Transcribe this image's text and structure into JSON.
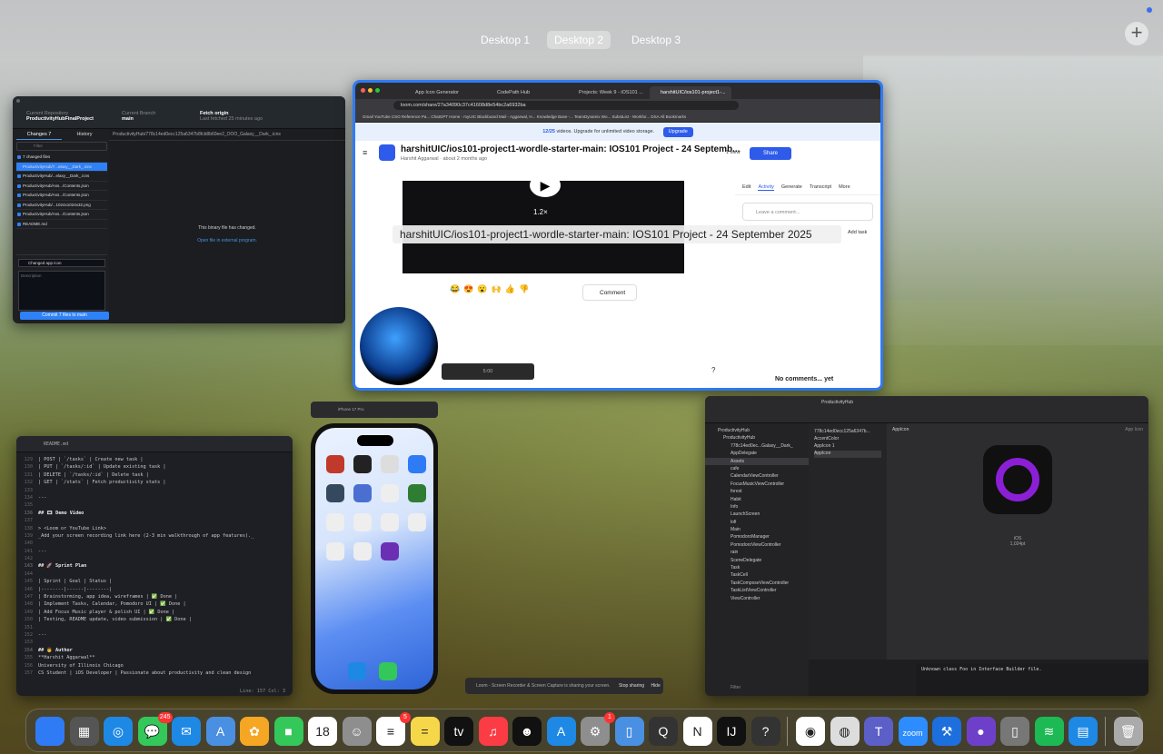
{
  "desktops": [
    "Desktop 1",
    "Desktop 2",
    "Desktop 3"
  ],
  "active_desktop": "Desktop 2",
  "add_desktop": "+",
  "github_desktop": {
    "repo_label": "Current Repository",
    "repo": "ProductivityHubFinalProject",
    "branch_label": "Current Branch",
    "branch": "main",
    "fetch_title": "Fetch origin",
    "fetch_sub": "Last fetched 25 minutes ago",
    "tab_changes": "Changes",
    "tab_changes_count": "7",
    "tab_history": "History",
    "filter_placeholder": "Filter",
    "changed_count": "7 changed files",
    "files": [
      "ProductivityHub/7...elaxy__Dark_.icns",
      "ProductivityHub/...elaxy__Dark_.icns",
      "ProductivityHub/Ass.../Contents.json",
      "ProductivityHub/Ass.../Contents.json",
      "ProductivityHub/...1024x1024x32.png",
      "ProductivityHub/Ass.../Contents.json",
      "README.md"
    ],
    "diff_path": "ProductivityHub/778c14ed0ecc125a6347b8fcb8b60ee2_OOO_Galaxy__Dark_.icns",
    "binary_msg": "This binary file has changed.",
    "open_link": "Open file in external program.",
    "summary": "Changed app icon",
    "description_placeholder": "Description",
    "commit_btn": "Commit 7 files to main"
  },
  "chrome": {
    "tabs": [
      "App Icon Generator",
      "CodePath Hub",
      "Projects: Week 9 - iOS101 ...",
      "harshitUIC/ios101-project1-..."
    ],
    "url": "loom.com/share/27a34090c37c41608d8e54bc2a6932ba",
    "bookmarks": "Gmail   YouTube   CSO Reference Pa...   ChatGPT   Home - myUIC   Blackboard   Mail - Aggarwal, H...   Knowledge Base -...   TeamDynamix Wo...   SubstList - Workfor...   DSA   All Bookmarks",
    "banner_text": "videos. Upgrade for unlimited video storage.",
    "banner_count": "12/25",
    "upgrade": "Upgrade",
    "video_title": "harshitUIC/ios101-project1-wordle-starter-main: IOS101 Project - 24 Septemb...",
    "author": "Harshit Aggarwal · about 2 months ago",
    "views": "1 view",
    "share": "Share",
    "tooltip": "harshitUIC/ios101-project1-wordle-starter-main: IOS101 Project - 24 September 2025",
    "speed": "1.2×",
    "right_tabs": [
      "Edit",
      "Activity",
      "Generate",
      "Transcript",
      "More"
    ],
    "comment_placeholder": "Leave a comment...",
    "add_task": "Add task",
    "no_comments": "No comments... yet",
    "comment_btn": "Comment",
    "time": "5:00",
    "help": "?"
  },
  "editor": {
    "filename": "README.md",
    "lines": [
      {
        "n": "129",
        "t": "| POST | `/tasks` | Create new task |"
      },
      {
        "n": "130",
        "t": "| PUT | `/tasks/:id` | Update existing task |"
      },
      {
        "n": "131",
        "t": "| DELETE | `/tasks/:id` | Delete task |"
      },
      {
        "n": "132",
        "t": "| GET | `/stats` | Fetch productivity stats |"
      },
      {
        "n": "133",
        "t": ""
      },
      {
        "n": "134",
        "t": "---"
      },
      {
        "n": "135",
        "t": ""
      },
      {
        "n": "136",
        "t": "## 🎞 Demo Video",
        "h": true
      },
      {
        "n": "137",
        "t": ""
      },
      {
        "n": "138",
        "t": "> <Loom or YouTube Link>"
      },
      {
        "n": "139",
        "t": "_Add your screen recording link here (2-3 min walkthrough of app features)._"
      },
      {
        "n": "140",
        "t": ""
      },
      {
        "n": "141",
        "t": "---"
      },
      {
        "n": "142",
        "t": ""
      },
      {
        "n": "143",
        "t": "## 🚀 Sprint Plan",
        "h": true
      },
      {
        "n": "144",
        "t": ""
      },
      {
        "n": "145",
        "t": "| Sprint | Goal | Status |"
      },
      {
        "n": "146",
        "t": "|--------|------|--------|"
      },
      {
        "n": "147",
        "t": "| Brainstorming, app idea, wireframes | ✅ Done |"
      },
      {
        "n": "148",
        "t": "| Implement Tasks, Calendar, Pomodoro UI | ✅ Done |"
      },
      {
        "n": "149",
        "t": "| Add Focus Music player & polish UI | ✅ Done |"
      },
      {
        "n": "150",
        "t": "| Testing, README update, video submission | ✅ Done |"
      },
      {
        "n": "151",
        "t": ""
      },
      {
        "n": "152",
        "t": "---"
      },
      {
        "n": "153",
        "t": ""
      },
      {
        "n": "154",
        "t": "## 👨 Author",
        "h": true
      },
      {
        "n": "155",
        "t": "**Harshit Aggarwal**"
      },
      {
        "n": "156",
        "t": "University of Illinois Chicago"
      },
      {
        "n": "157",
        "t": "CS Student | iOS Developer | Passionate about productivity and clean design"
      }
    ],
    "status": "Line: 157  Col: 3"
  },
  "simulator": {
    "title": "iPhone 17 Pro",
    "subtitle": "iOS 26.0"
  },
  "xcode": {
    "project": "ProductivityHub",
    "nav": [
      "ProductivityHub",
      "ProductivityHub",
      "778c14ed0ec...Galaxy__Dark_",
      "AppDelegate",
      "Assets",
      "cafe",
      "CalendarViewController",
      "FocusMusicViewController",
      "forest",
      "Habit",
      "Info",
      "LaunchScreen",
      "lofi",
      "Main",
      "PomodoroManager",
      "PomodoroViewController",
      "rain",
      "SceneDelegate",
      "Task",
      "TaskCell",
      "TaskComposeViewController",
      "TaskListViewController",
      "ViewController"
    ],
    "assets": [
      "778c14ed0ecc125a6347b...",
      "AccentColor",
      "AppIcon 1",
      "AppIcon"
    ],
    "canvas_title": "AppIcon",
    "canvas_right": "App Icon",
    "icon_caption": "iOS",
    "icon_size": "1,024pt",
    "console": "Unknown class Foo in Interface Builder file.",
    "filter": "Filter"
  },
  "sharing_bar": {
    "text": "Loom - Screen Recorder & Screen Capture is sharing your screen.",
    "stop": "Stop sharing",
    "hide": "Hide"
  },
  "dock": [
    {
      "name": "finder-icon",
      "color": "#2f7bf6",
      "glyph": ""
    },
    {
      "name": "launchpad-icon",
      "color": "#555",
      "glyph": "▦"
    },
    {
      "name": "safari-icon",
      "color": "#1e88e5",
      "glyph": "◎"
    },
    {
      "name": "messages-icon",
      "color": "#34c759",
      "glyph": "💬",
      "badge": "245"
    },
    {
      "name": "mail-icon",
      "color": "#1e88e5",
      "glyph": "✉"
    },
    {
      "name": "maps-icon",
      "color": "#4a90e2",
      "glyph": "A"
    },
    {
      "name": "photos-icon",
      "color": "#f5a623",
      "glyph": "✿"
    },
    {
      "name": "facetime-icon",
      "color": "#34c759",
      "glyph": "■"
    },
    {
      "name": "calendar-icon",
      "color": "#fff",
      "glyph": "18"
    },
    {
      "name": "contacts-icon",
      "color": "#8e8e8e",
      "glyph": "☺"
    },
    {
      "name": "reminders-icon",
      "color": "#fff",
      "glyph": "≡",
      "badge": "5"
    },
    {
      "name": "notes-icon",
      "color": "#f7d74a",
      "glyph": "="
    },
    {
      "name": "tv-icon",
      "color": "#111",
      "glyph": "tv"
    },
    {
      "name": "music-icon",
      "color": "#fc3c44",
      "glyph": "♫"
    },
    {
      "name": "mirror-icon",
      "color": "#111",
      "glyph": "☻"
    },
    {
      "name": "appstore-icon",
      "color": "#1e88e5",
      "glyph": "A"
    },
    {
      "name": "settings-icon",
      "color": "#8e8e8e",
      "glyph": "⚙",
      "badge": "1"
    },
    {
      "name": "iphone-mirroring-icon",
      "color": "#4a90e2",
      "glyph": "▯"
    },
    {
      "name": "qr-icon",
      "color": "#333",
      "glyph": "Q"
    },
    {
      "name": "notion-icon",
      "color": "#fff",
      "glyph": "N"
    },
    {
      "name": "jetbrains-icon",
      "color": "#111",
      "glyph": "IJ"
    },
    {
      "name": "help-icon",
      "color": "#333",
      "glyph": "?"
    },
    {
      "name": "chrome-icon",
      "color": "#fff",
      "glyph": "◉"
    },
    {
      "name": "vpn-icon",
      "color": "#ddd",
      "glyph": "◍"
    },
    {
      "name": "teams-icon",
      "color": "#5b5fc7",
      "glyph": "T"
    },
    {
      "name": "zoom-icon",
      "color": "#2d8cff",
      "glyph": "zoom"
    },
    {
      "name": "xcode-icon",
      "color": "#1c6fdd",
      "glyph": "⚒"
    },
    {
      "name": "github-icon",
      "color": "#6e40c9",
      "glyph": "●"
    },
    {
      "name": "simulator-icon",
      "color": "#777",
      "glyph": "▯"
    },
    {
      "name": "spotify-icon",
      "color": "#1db954",
      "glyph": "≋"
    },
    {
      "name": "files-icon",
      "color": "#1e88e5",
      "glyph": "▤"
    },
    {
      "name": "trash-icon",
      "color": "#aaa",
      "glyph": "🗑"
    }
  ]
}
